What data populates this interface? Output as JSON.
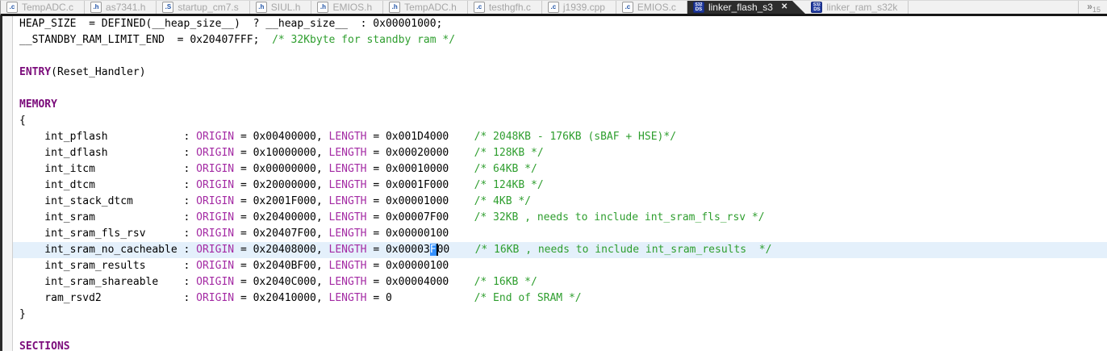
{
  "tab_bar": {
    "tabs": [
      {
        "label": "TempADC.c",
        "icon": "c-file-icon",
        "active": false
      },
      {
        "label": "as7341.h",
        "icon": "h-file-icon",
        "active": false
      },
      {
        "label": "startup_cm7.s",
        "icon": "asm-file-icon",
        "active": false
      },
      {
        "label": "SIUL.h",
        "icon": "h-file-icon",
        "active": false
      },
      {
        "label": "EMIOS.h",
        "icon": "h-file-icon",
        "active": false
      },
      {
        "label": "TempADC.h",
        "icon": "h-file-icon",
        "active": false
      },
      {
        "label": "testhgfh.c",
        "icon": "c-file-icon",
        "active": false
      },
      {
        "label": "j1939.cpp",
        "icon": "c-file-icon",
        "active": false
      },
      {
        "label": "EMIOS.c",
        "icon": "c-file-icon",
        "active": false
      },
      {
        "label": "linker_flash_s3",
        "icon": "s32ds-file-icon",
        "active": true,
        "close_glyph": "✕"
      },
      {
        "label": "linker_ram_s32k",
        "icon": "s32ds-file-icon",
        "active": false
      }
    ],
    "overflow": {
      "chevron": "»",
      "count": "15"
    }
  },
  "colors": {
    "keyword": "#A42BA4",
    "keyword_bold": "#7B0C7B",
    "comment": "#2E9E2E",
    "selection_bg": "#3390FF",
    "current_line_bg": "#E4F0FB",
    "active_tab_bg": "#2D2D2D"
  },
  "editor": {
    "language": "linker-script",
    "lines": [
      {
        "hl": false,
        "seg": [
          [
            "p",
            "HEAP_SIZE  = DEFINED(__heap_size__)  ? __heap_size__  : 0x00001000;"
          ]
        ]
      },
      {
        "hl": false,
        "seg": [
          [
            "p",
            "__STANDBY_RAM_LIMIT_END  = 0x20407FFF;  "
          ],
          [
            "c",
            "/* 32Kbyte for standby ram */"
          ]
        ]
      },
      {
        "hl": false,
        "seg": []
      },
      {
        "hl": false,
        "seg": [
          [
            "kb",
            "ENTRY"
          ],
          [
            "p",
            "(Reset_Handler)"
          ]
        ]
      },
      {
        "hl": false,
        "seg": []
      },
      {
        "hl": false,
        "seg": [
          [
            "kb",
            "MEMORY"
          ]
        ]
      },
      {
        "hl": false,
        "seg": [
          [
            "p",
            "{"
          ]
        ]
      },
      {
        "hl": false,
        "seg": [
          [
            "p",
            "    int_pflash            : "
          ],
          [
            "k",
            "ORIGIN"
          ],
          [
            "p",
            " = 0x00400000, "
          ],
          [
            "k",
            "LENGTH"
          ],
          [
            "p",
            " = 0x001D4000    "
          ],
          [
            "c",
            "/* 2048KB - 176KB (sBAF + HSE)*/"
          ]
        ]
      },
      {
        "hl": false,
        "seg": [
          [
            "p",
            "    int_dflash            : "
          ],
          [
            "k",
            "ORIGIN"
          ],
          [
            "p",
            " = 0x10000000, "
          ],
          [
            "k",
            "LENGTH"
          ],
          [
            "p",
            " = 0x00020000    "
          ],
          [
            "c",
            "/* 128KB */"
          ]
        ]
      },
      {
        "hl": false,
        "seg": [
          [
            "p",
            "    int_itcm              : "
          ],
          [
            "k",
            "ORIGIN"
          ],
          [
            "p",
            " = 0x00000000, "
          ],
          [
            "k",
            "LENGTH"
          ],
          [
            "p",
            " = 0x00010000    "
          ],
          [
            "c",
            "/* 64KB */"
          ]
        ]
      },
      {
        "hl": false,
        "seg": [
          [
            "p",
            "    int_dtcm              : "
          ],
          [
            "k",
            "ORIGIN"
          ],
          [
            "p",
            " = 0x20000000, "
          ],
          [
            "k",
            "LENGTH"
          ],
          [
            "p",
            " = 0x0001F000    "
          ],
          [
            "c",
            "/* 124KB */"
          ]
        ]
      },
      {
        "hl": false,
        "seg": [
          [
            "p",
            "    int_stack_dtcm        : "
          ],
          [
            "k",
            "ORIGIN"
          ],
          [
            "p",
            " = 0x2001F000, "
          ],
          [
            "k",
            "LENGTH"
          ],
          [
            "p",
            " = 0x00001000    "
          ],
          [
            "c",
            "/* 4KB */"
          ]
        ]
      },
      {
        "hl": false,
        "seg": [
          [
            "p",
            "    int_sram              : "
          ],
          [
            "k",
            "ORIGIN"
          ],
          [
            "p",
            " = 0x20400000, "
          ],
          [
            "k",
            "LENGTH"
          ],
          [
            "p",
            " = 0x00007F00    "
          ],
          [
            "c",
            "/* 32KB , needs to include int_sram_fls_rsv */"
          ]
        ]
      },
      {
        "hl": false,
        "seg": [
          [
            "p",
            "    int_sram_fls_rsv      : "
          ],
          [
            "k",
            "ORIGIN"
          ],
          [
            "p",
            " = 0x20407F00, "
          ],
          [
            "k",
            "LENGTH"
          ],
          [
            "p",
            " = 0x00000100"
          ]
        ]
      },
      {
        "hl": true,
        "seg": [
          [
            "p",
            "    int_sram_no_cacheable : "
          ],
          [
            "k",
            "ORIGIN"
          ],
          [
            "p",
            " = 0x20408000, "
          ],
          [
            "k",
            "LENGTH"
          ],
          [
            "p",
            " = 0x00003"
          ],
          [
            "sel",
            "F"
          ],
          [
            "caret",
            ""
          ],
          [
            "p",
            "00    "
          ],
          [
            "c",
            "/* 16KB , needs to include int_sram_results  */"
          ]
        ]
      },
      {
        "hl": false,
        "seg": [
          [
            "p",
            "    int_sram_results      : "
          ],
          [
            "k",
            "ORIGIN"
          ],
          [
            "p",
            " = 0x2040BF00, "
          ],
          [
            "k",
            "LENGTH"
          ],
          [
            "p",
            " = 0x00000100"
          ]
        ]
      },
      {
        "hl": false,
        "seg": [
          [
            "p",
            "    int_sram_shareable    : "
          ],
          [
            "k",
            "ORIGIN"
          ],
          [
            "p",
            " = 0x2040C000, "
          ],
          [
            "k",
            "LENGTH"
          ],
          [
            "p",
            " = 0x00004000    "
          ],
          [
            "c",
            "/* 16KB */"
          ]
        ]
      },
      {
        "hl": false,
        "seg": [
          [
            "p",
            "    ram_rsvd2             : "
          ],
          [
            "k",
            "ORIGIN"
          ],
          [
            "p",
            " = 0x20410000, "
          ],
          [
            "k",
            "LENGTH"
          ],
          [
            "p",
            " = 0             "
          ],
          [
            "c",
            "/* End of SRAM */"
          ]
        ]
      },
      {
        "hl": false,
        "seg": [
          [
            "p",
            "}"
          ]
        ]
      },
      {
        "hl": false,
        "seg": []
      },
      {
        "hl": false,
        "seg": [
          [
            "kb",
            "SECTIONS"
          ]
        ]
      }
    ]
  }
}
